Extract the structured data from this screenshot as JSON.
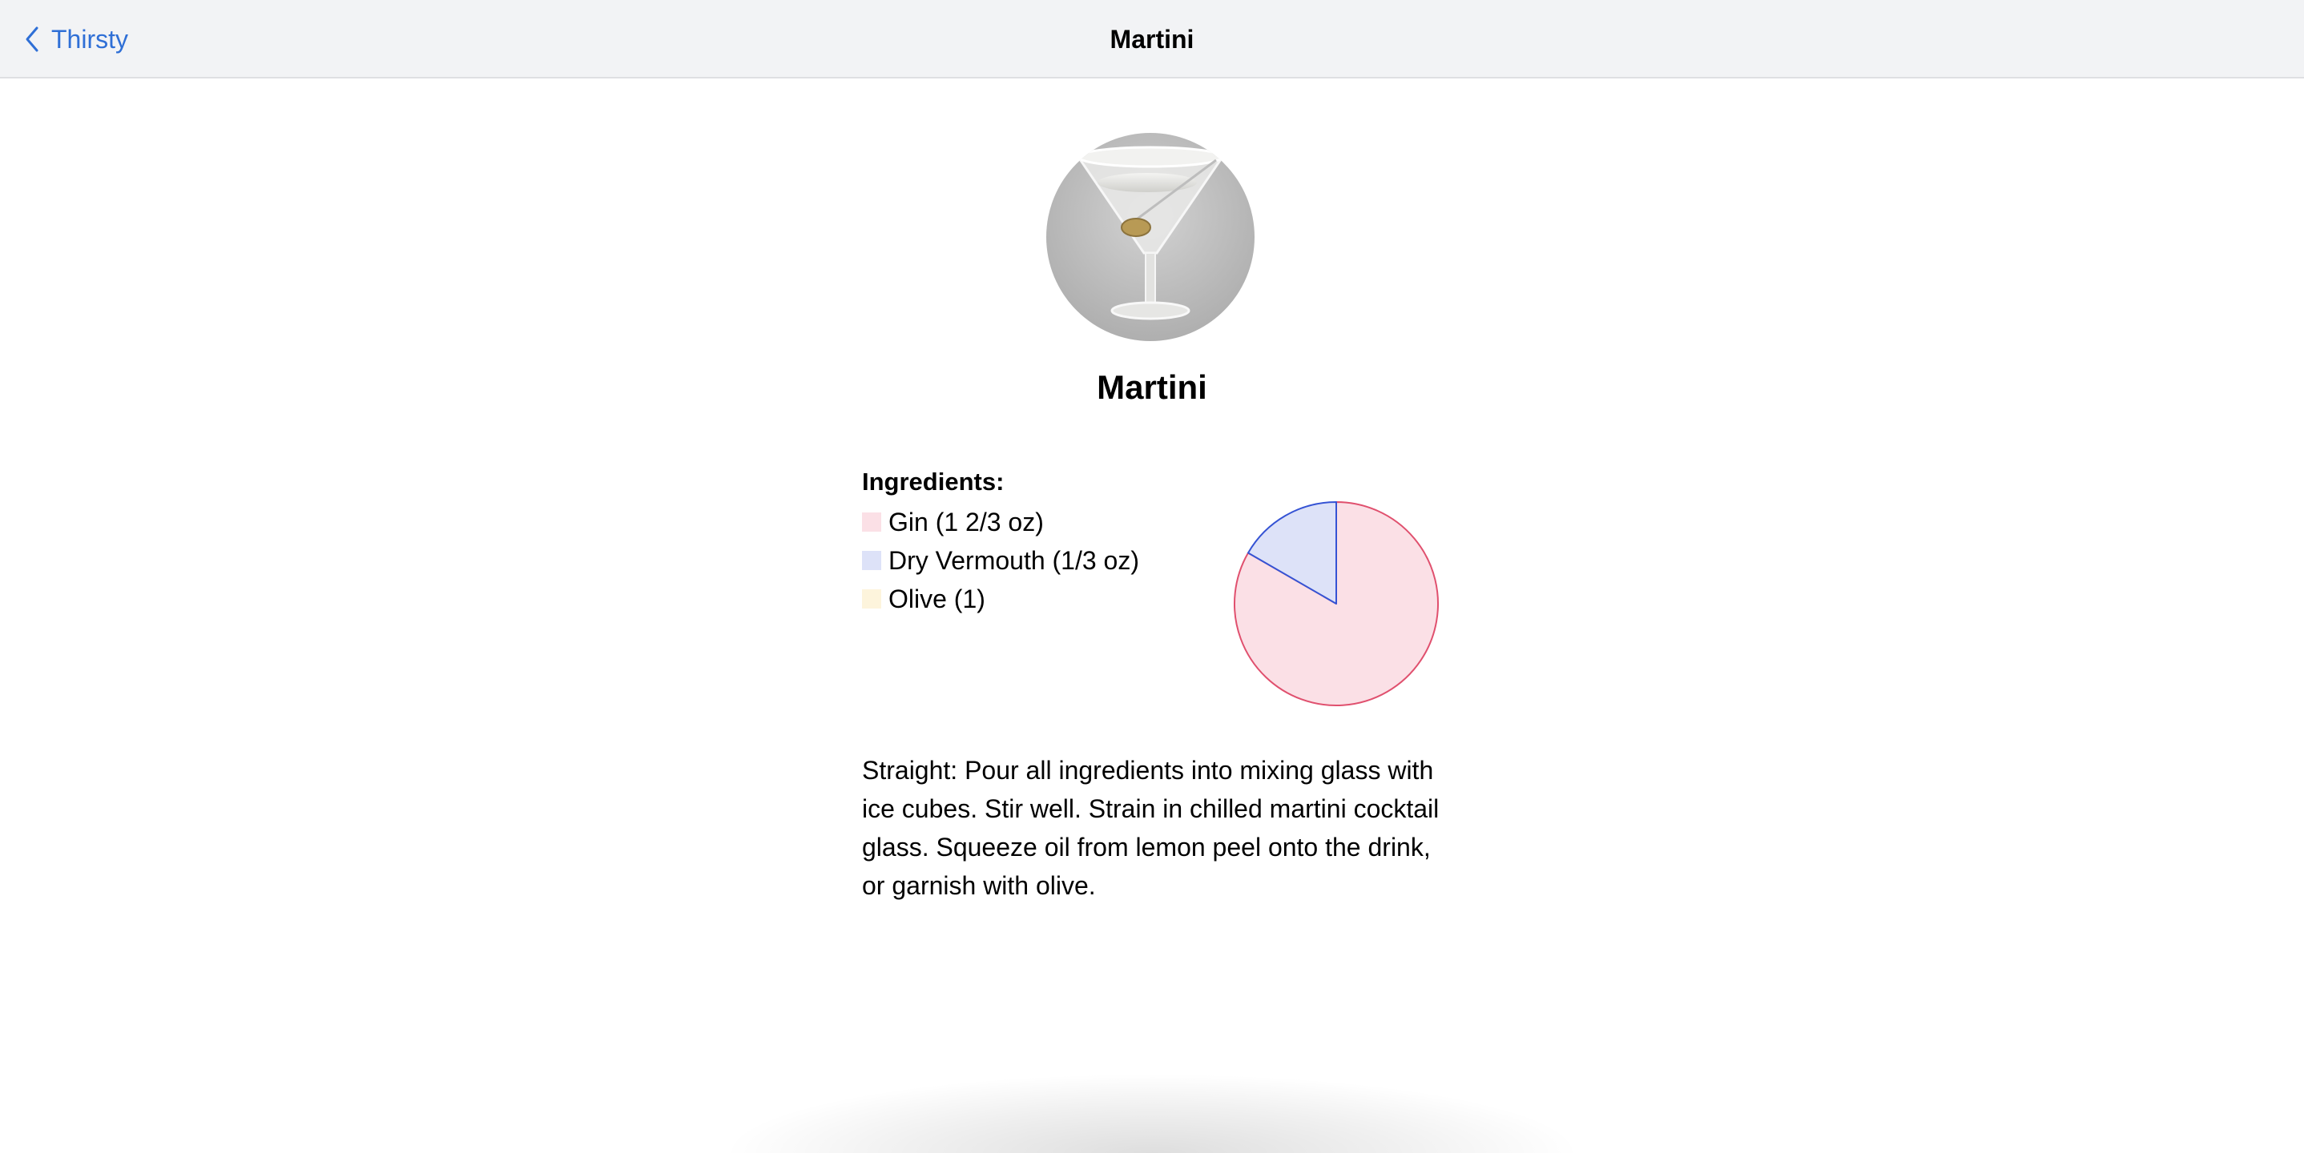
{
  "nav": {
    "back_label": "Thirsty",
    "title": "Martini"
  },
  "drink": {
    "name": "Martini",
    "image_icon": "martini-glass-photo"
  },
  "ingredients": {
    "heading": "Ingredients:",
    "items": [
      {
        "label": "Gin (1 2/3 oz)",
        "amount": 1.6667,
        "fill": "#fbe0e6",
        "stroke": "#e0506e"
      },
      {
        "label": "Dry Vermouth (1/3 oz)",
        "amount": 0.3333,
        "fill": "#dde2f8",
        "stroke": "#3553d4"
      },
      {
        "label": "Olive (1)",
        "amount": 0,
        "fill": "#fdf4dc",
        "stroke": "#e8c86a"
      }
    ]
  },
  "chart_data": {
    "type": "pie",
    "categories": [
      "Gin (1 2/3 oz)",
      "Dry Vermouth (1/3 oz)",
      "Olive (1)"
    ],
    "values": [
      1.6667,
      0.3333,
      0
    ]
  },
  "instructions": "Straight: Pour all ingredients into mixing glass with ice cubes. Stir well. Strain in chilled martini cocktail glass. Squeeze oil from lemon peel onto the drink, or garnish with olive."
}
